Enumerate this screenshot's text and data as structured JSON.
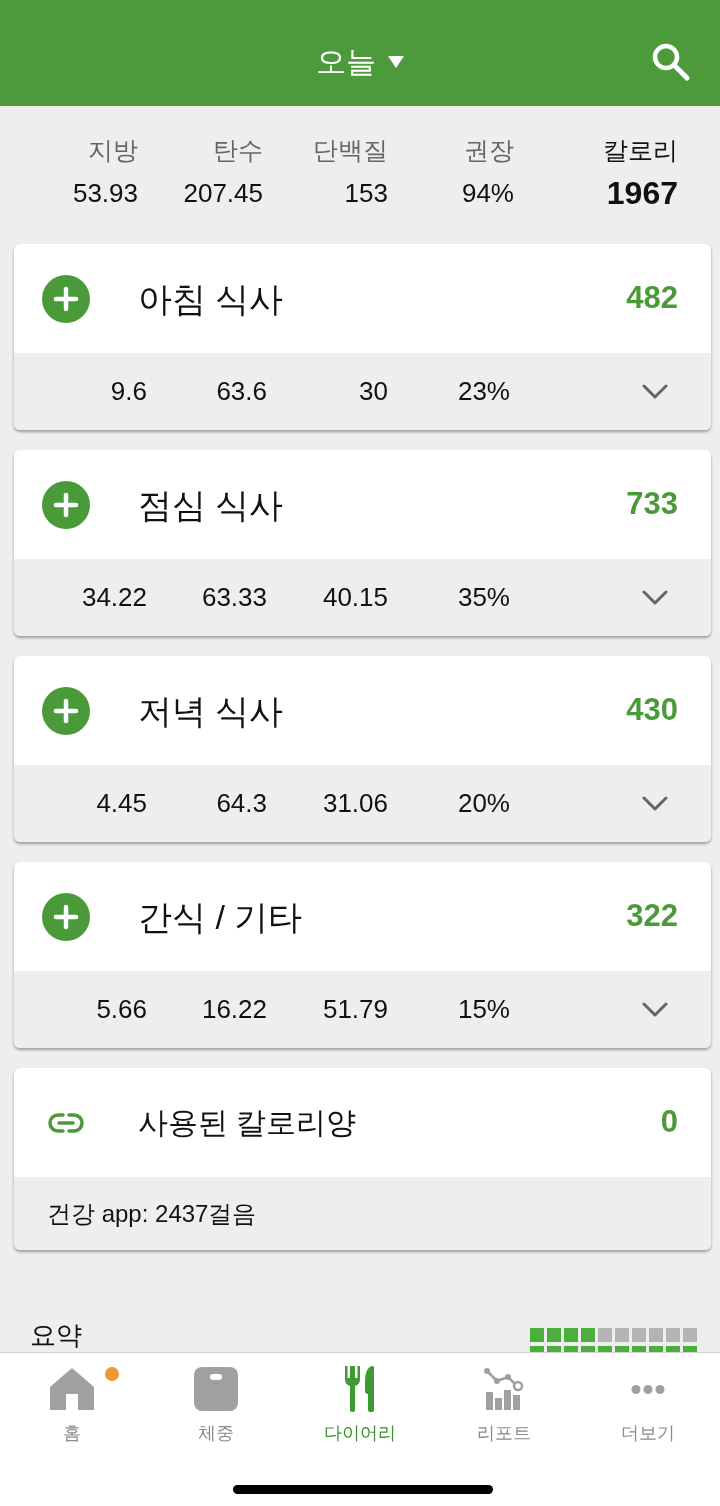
{
  "header": {
    "title": "오늘"
  },
  "totals": [
    {
      "kind": "macro",
      "label": "지방",
      "value": "53.93"
    },
    {
      "kind": "macro",
      "label": "탄수",
      "value": "207.45"
    },
    {
      "kind": "macro",
      "label": "단백질",
      "value": "153"
    },
    {
      "kind": "macro",
      "label": "권장",
      "value": "94%"
    },
    {
      "kind": "total",
      "label": "칼로리",
      "value": "1967"
    }
  ],
  "meals": [
    {
      "name": "아침 식사",
      "calories": "482",
      "values": [
        "9.6",
        "63.6",
        "30",
        "23%"
      ],
      "expanded": false
    },
    {
      "name": "점심 식사",
      "calories": "733",
      "values": [
        "34.22",
        "63.33",
        "40.15",
        "35%"
      ],
      "expanded": false
    },
    {
      "name": "저녁 식사",
      "calories": "430",
      "values": [
        "4.45",
        "64.3",
        "31.06",
        "20%"
      ],
      "expanded": false
    },
    {
      "name": "간식 / 기타",
      "calories": "322",
      "values": [
        "5.66",
        "16.22",
        "51.79",
        "15%"
      ],
      "expanded": false
    }
  ],
  "burned": {
    "label": "사용된 칼로리양",
    "value": "0",
    "note": "건강 app: 2437걸음"
  },
  "summary": {
    "title": "요약",
    "meter_rows": [
      {
        "level": 0.4
      },
      {
        "level": 1
      }
    ]
  },
  "tabs": [
    {
      "kind": "home",
      "label": "홈",
      "selected": false,
      "notification": true
    },
    {
      "kind": "weight",
      "label": "체중",
      "selected": false,
      "notification": false
    },
    {
      "kind": "diary",
      "label": "다이어리",
      "selected": true,
      "notification": false
    },
    {
      "kind": "report",
      "label": "리포트",
      "selected": false,
      "notification": false
    },
    {
      "kind": "more",
      "label": "더보기",
      "selected": false,
      "notification": false
    }
  ]
}
